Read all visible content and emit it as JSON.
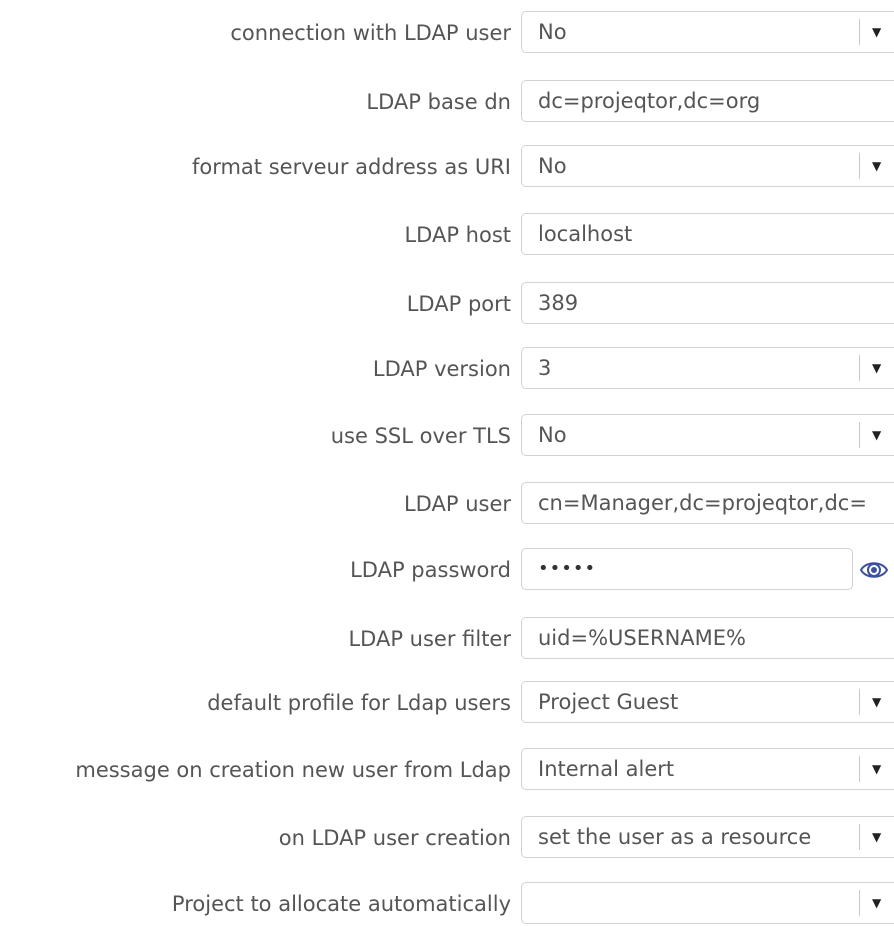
{
  "fields": {
    "connection_with_ldap_user": {
      "label": "connection with LDAP user",
      "value": "No"
    },
    "ldap_base_dn": {
      "label": "LDAP base dn",
      "value": "dc=projeqtor,dc=org"
    },
    "format_server_uri": {
      "label": "format serveur address as URI",
      "value": "No"
    },
    "ldap_host": {
      "label": "LDAP host",
      "value": "localhost"
    },
    "ldap_port": {
      "label": "LDAP port",
      "value": "389"
    },
    "ldap_version": {
      "label": "LDAP version",
      "value": "3"
    },
    "use_ssl_over_tls": {
      "label": "use SSL over TLS",
      "value": "No"
    },
    "ldap_user": {
      "label": "LDAP user",
      "value": "cn=Manager,dc=projeqtor,dc="
    },
    "ldap_password": {
      "label": "LDAP password",
      "value": "•••••"
    },
    "ldap_user_filter": {
      "label": "LDAP user filter",
      "value": "uid=%USERNAME%"
    },
    "default_profile": {
      "label": "default profile for Ldap users",
      "value": "Project Guest"
    },
    "message_on_creation": {
      "label": "message on creation new user from Ldap",
      "value": "Internal alert"
    },
    "on_user_creation": {
      "label": "on LDAP user creation",
      "value": "set the user as a resource"
    },
    "project_to_allocate": {
      "label": "Project to allocate automatically",
      "value": ""
    }
  },
  "icons": {
    "dropdown_arrow": "▼",
    "password_reveal": "eye-icon"
  },
  "colors": {
    "label_text": "#555555",
    "field_border": "#d2d2d2",
    "eye_icon": "#3c4fa0"
  }
}
